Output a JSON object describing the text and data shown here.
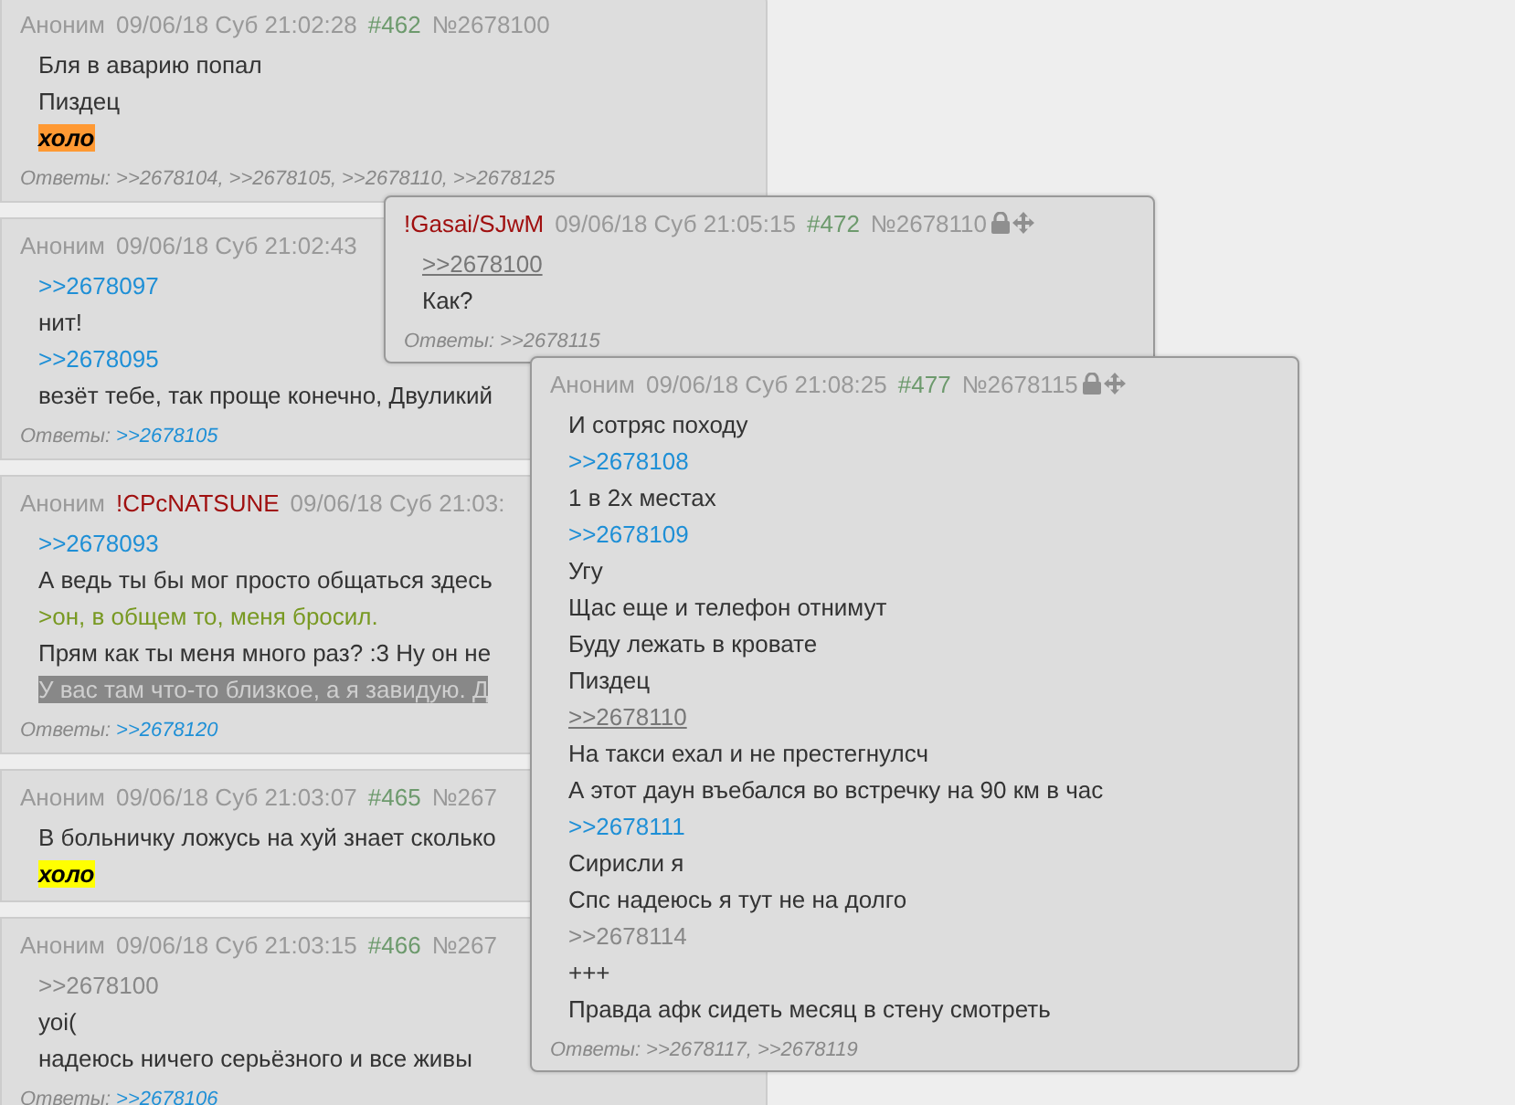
{
  "posts": [
    {
      "name": "Аноним",
      "date": "09/06/18 Суб 21:02:28",
      "num": "#462",
      "no": "№2678100",
      "lines": [
        {
          "kind": "text",
          "text": "Бля в аварию попал"
        },
        {
          "kind": "text",
          "text": "Пиздец"
        },
        {
          "kind": "mark",
          "text": "холо",
          "color": "#ff9933"
        }
      ],
      "replies_label": "Ответы:",
      "replies": [
        {
          "kind": "link",
          "text": ">>2678104"
        },
        {
          "kind": "sep",
          "text": ","
        },
        {
          "kind": "link",
          "text": ">>2678105"
        },
        {
          "kind": "sep",
          "text": ","
        },
        {
          "kind": "link",
          "text": ">>2678110"
        },
        {
          "kind": "sep",
          "text": ","
        },
        {
          "kind": "link",
          "text": ">>2678125"
        }
      ]
    },
    {
      "name": "Аноним",
      "date": "09/06/18 Суб 21:02:43",
      "lines": [
        {
          "kind": "link",
          "text": ">>2678097"
        },
        {
          "kind": "text",
          "text": "нит!"
        },
        {
          "kind": "link",
          "text": ">>2678095"
        },
        {
          "kind": "text",
          "text": "везёт тебе, так проще конечно, Двуликий"
        }
      ],
      "replies_label": "Ответы:",
      "replies": [
        {
          "kind": "link",
          "text": ">>2678105"
        }
      ]
    },
    {
      "name": "Аноним",
      "trip": "!CPcNATSUNE",
      "date": "09/06/18 Суб 21:03:",
      "lines": [
        {
          "kind": "link",
          "text": ">>2678093"
        },
        {
          "kind": "text",
          "text": "А ведь ты бы мог просто общаться здесь"
        },
        {
          "kind": "quote",
          "text": ">он, в общем то, меня бросил."
        },
        {
          "kind": "text",
          "text": "Прям как ты меня много раз? :3 Ну он не"
        },
        {
          "kind": "spoiler",
          "text": "У вас там что-то близкое, а я завидую. Д"
        }
      ],
      "replies_label": "Ответы:",
      "replies": [
        {
          "kind": "link",
          "text": ">>2678120"
        }
      ]
    },
    {
      "name": "Аноним",
      "date": "09/06/18 Суб 21:03:07",
      "num": "#465",
      "no": "№267",
      "lines": [
        {
          "kind": "text",
          "text": "В больничку ложусь на хуй знает сколько"
        },
        {
          "kind": "mark",
          "text": "холо",
          "color": "#ffff00"
        }
      ]
    },
    {
      "name": "Аноним",
      "date": "09/06/18 Суб 21:03:15",
      "num": "#466",
      "no": "№267",
      "lines": [
        {
          "kind": "dead",
          "text": ">>2678100"
        },
        {
          "kind": "text",
          "text": "уоі("
        },
        {
          "kind": "text",
          "text": "надеюсь ничего серьёзного и все живы"
        }
      ],
      "replies_label": "Ответы:",
      "replies": [
        {
          "kind": "link",
          "text": ">>2678106"
        }
      ]
    }
  ],
  "popups": [
    {
      "trip": "!Gasai/SJwM",
      "date": "09/06/18 Суб 21:05:15",
      "num": "#472",
      "no": "№2678110",
      "lines": [
        {
          "kind": "current",
          "text": ">>2678100"
        },
        {
          "kind": "text",
          "text": "Как?"
        }
      ],
      "replies_label": "Ответы:",
      "replies": [
        {
          "kind": "link",
          "text": ">>2678115"
        }
      ]
    },
    {
      "name": "Аноним",
      "date": "09/06/18 Суб 21:08:25",
      "num": "#477",
      "no": "№2678115",
      "lines": [
        {
          "kind": "text",
          "text": "И сотряс походу"
        },
        {
          "kind": "link",
          "text": ">>2678108"
        },
        {
          "kind": "text",
          "text": "1 в 2х местах"
        },
        {
          "kind": "link",
          "text": ">>2678109"
        },
        {
          "kind": "text",
          "text": "Угу"
        },
        {
          "kind": "text",
          "text": "Щас еще и телефон отнимут"
        },
        {
          "kind": "text",
          "text": "Буду лежать в кровате"
        },
        {
          "kind": "text",
          "text": "Пиздец"
        },
        {
          "kind": "current",
          "text": ">>2678110"
        },
        {
          "kind": "text",
          "text": "На такси ехал и не престегнулсч"
        },
        {
          "kind": "text",
          "text": "А этот даун въебался во встречку на 90 км в час"
        },
        {
          "kind": "link",
          "text": ">>2678111"
        },
        {
          "kind": "text",
          "text": "Сирисли я"
        },
        {
          "kind": "text",
          "text": "Спс надеюсь я тут не на долго"
        },
        {
          "kind": "dead",
          "text": ">>2678114"
        },
        {
          "kind": "text",
          "text": "+++"
        },
        {
          "kind": "text",
          "text": "Правда афк сидеть месяц в стену смотреть"
        }
      ],
      "replies_label": "Ответы:",
      "replies": [
        {
          "kind": "link",
          "text": ">>2678117"
        },
        {
          "kind": "sep",
          "text": ","
        },
        {
          "kind": "link",
          "text": ">>2678119"
        }
      ]
    }
  ]
}
